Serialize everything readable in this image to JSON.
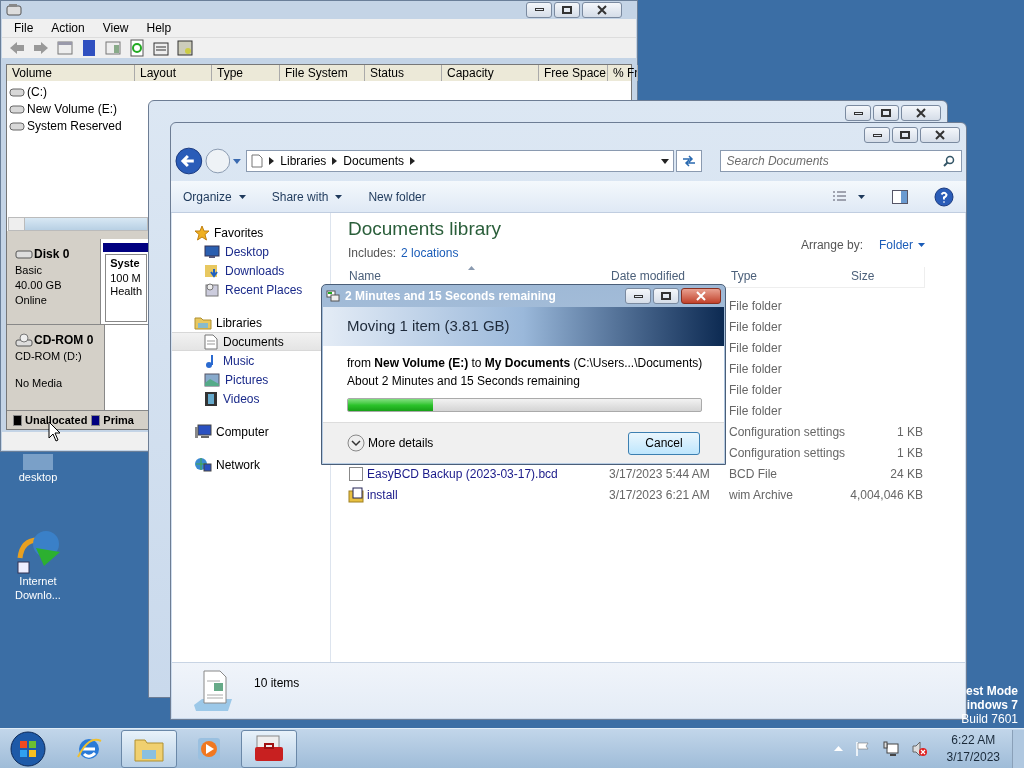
{
  "disk_management": {
    "menu": [
      "File",
      "Action",
      "View",
      "Help"
    ],
    "columns": [
      "Volume",
      "Layout",
      "Type",
      "File System",
      "Status",
      "Capacity",
      "Free Space",
      "% Fr"
    ],
    "volumes": [
      "(C:)",
      "New Volume (E:)",
      "System Reserved"
    ],
    "disks": [
      {
        "kind": "disk",
        "name": "Disk 0",
        "lines": [
          "Basic",
          "40.00 GB",
          "Online"
        ],
        "partition": {
          "name": "Syste",
          "lines": [
            "100 M",
            "Health"
          ]
        }
      },
      {
        "kind": "cdrom",
        "name": "CD-ROM 0",
        "lines": [
          "CD-ROM (D:)",
          "No Media"
        ]
      }
    ],
    "legend": [
      {
        "label": "Unallocated",
        "color": "#000000"
      },
      {
        "label": "Prima",
        "color": "#000080"
      }
    ]
  },
  "explorer": {
    "breadcrumb": [
      "Libraries",
      "Documents"
    ],
    "search": {
      "placeholder": "Search Documents"
    },
    "commands": [
      {
        "label": "Organize",
        "menu": true
      },
      {
        "label": "Share with",
        "menu": true
      },
      {
        "label": "New folder",
        "menu": false
      }
    ],
    "nav": [
      {
        "label": "Favorites",
        "children": [
          {
            "label": "Desktop",
            "selected": false
          },
          {
            "label": "Downloads",
            "selected": false
          },
          {
            "label": "Recent Places",
            "selected": false
          }
        ]
      },
      {
        "label": "Libraries",
        "children": [
          {
            "label": "Documents",
            "selected": true
          },
          {
            "label": "Music",
            "selected": false
          },
          {
            "label": "Pictures",
            "selected": false
          },
          {
            "label": "Videos",
            "selected": false
          }
        ]
      },
      {
        "label": "Computer"
      },
      {
        "label": "Network"
      }
    ],
    "library": {
      "title": "Documents library",
      "includes_label": "Includes:",
      "includes_link": "2 locations",
      "arrange_label": "Arrange by:",
      "arrange_value": "Folder"
    },
    "columns": [
      "Name",
      "Date modified",
      "Type",
      "Size"
    ],
    "files": [
      {
        "type": "File folder"
      },
      {
        "type": "File folder"
      },
      {
        "type": "File folder"
      },
      {
        "type": "File folder"
      },
      {
        "type": "File folder"
      },
      {
        "type": "File folder"
      },
      {
        "type": "Configuration settings",
        "size": "1 KB"
      },
      {
        "type": "Configuration settings",
        "size": "1 KB"
      },
      {
        "kind": "bcd",
        "name": "EasyBCD Backup (2023-03-17).bcd",
        "date": "3/17/2023 5:44 AM",
        "type": "BCD File",
        "size": "24 KB"
      },
      {
        "kind": "wim",
        "name": "install",
        "date": "3/17/2023 6:21 AM",
        "type": "wim Archive",
        "size": "4,004,046 KB"
      }
    ],
    "status": "10 items"
  },
  "copy_dialog": {
    "title": "2 Minutes and 15 Seconds remaining",
    "heading": "Moving 1 item (3.81 GB)",
    "detail": "from **New Volume (E:)** to **My Documents** (C:\\Users...\\Documents)",
    "remaining": "About 2 Minutes and 15 Seconds remaining",
    "level": 0.24,
    "more": "More details",
    "cancel": "Cancel"
  },
  "desktop_icons": [
    {
      "kind": "folder",
      "label": "desktop"
    },
    {
      "kind": "downloader",
      "label": "Internet Downlo..."
    }
  ],
  "test_mode": [
    "est Mode",
    "indows 7",
    "Build 7601"
  ],
  "taskbar": {
    "apps": [
      {
        "kind": "ie",
        "active": false
      },
      {
        "kind": "explorer",
        "active": true
      },
      {
        "kind": "media",
        "active": false
      },
      {
        "kind": "toolbox",
        "active": true
      }
    ],
    "time": "6:22 AM",
    "date": "3/17/2023"
  }
}
